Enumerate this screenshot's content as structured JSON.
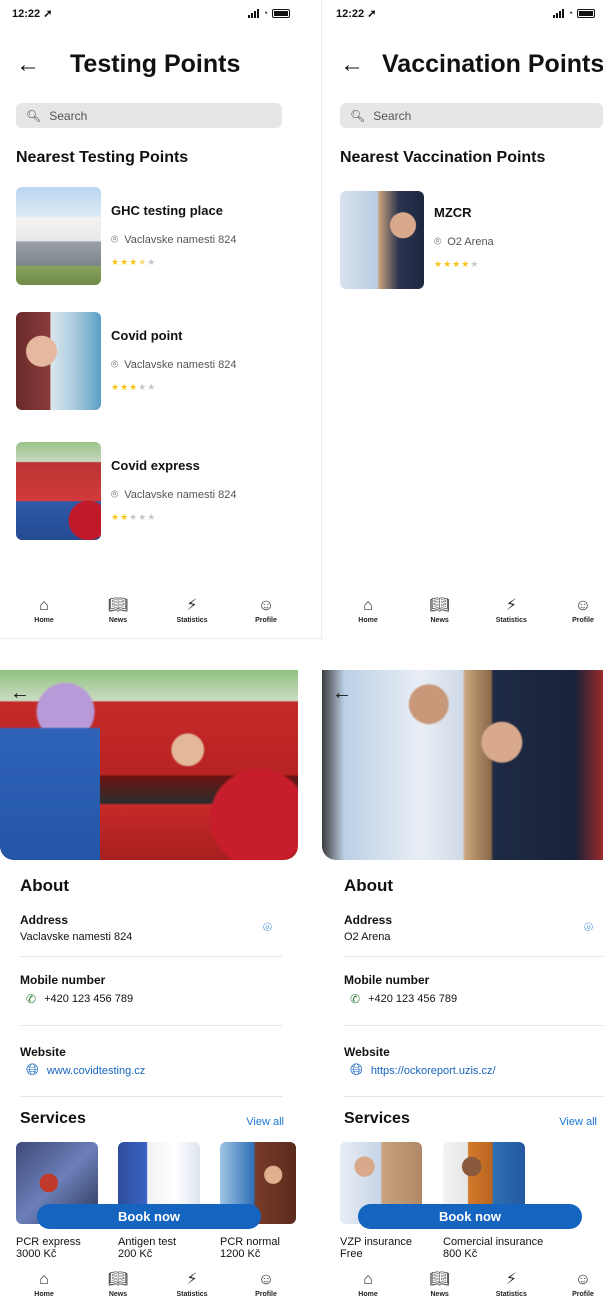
{
  "testing_list": {
    "time": "12:22 ➚",
    "title": "Testing Points",
    "search_placeholder": "Search",
    "section": "Nearest Testing Points",
    "places": [
      {
        "name": "GHC testing place",
        "address": "Vaclavske namesti 824",
        "rating": 3.5
      },
      {
        "name": "Covid point",
        "address": "Vaclavske namesti 824",
        "rating": 3
      },
      {
        "name": "Covid express",
        "address": "Vaclavske namesti 824",
        "rating": 2
      }
    ]
  },
  "vaccination_list": {
    "time": "12:22 ➚",
    "title": "Vaccination Points",
    "search_placeholder": "Search",
    "section": "Nearest Vaccination Points",
    "places": [
      {
        "name": "MZCR",
        "address": "O2 Arena",
        "rating": 4
      }
    ]
  },
  "tabs": [
    "Home",
    "News",
    "Statistics",
    "Profile"
  ],
  "testing_detail": {
    "about": "About",
    "address_label": "Address",
    "address": "Vaclavske namesti 824",
    "mobile_label": "Mobile number",
    "mobile": "+420 123 456 789",
    "website_label": "Website",
    "website": "www.covidtesting.cz",
    "services_title": "Services",
    "view_all": "View all",
    "services": [
      {
        "name": "PCR express",
        "price": "3000 Kč"
      },
      {
        "name": "Antigen test",
        "price": "200 Kč"
      },
      {
        "name": "PCR normal",
        "price": "1200 Kč"
      }
    ],
    "book": "Book now"
  },
  "vaccination_detail": {
    "about": "About",
    "address_label": "Address",
    "address": "O2 Arena",
    "mobile_label": "Mobile number",
    "mobile": "+420 123 456 789",
    "website_label": "Website",
    "website": "https://ockoreport.uzis.cz/",
    "services_title": "Services",
    "view_all": "View all",
    "services": [
      {
        "name": "VZP insurance",
        "price": "Free"
      },
      {
        "name": "Comercial insurance",
        "price": "800 Kč"
      }
    ],
    "book": "Book now"
  },
  "colors": {
    "accent": "#1565c0",
    "star": "#f5c518",
    "phone": "#2e7d32"
  }
}
